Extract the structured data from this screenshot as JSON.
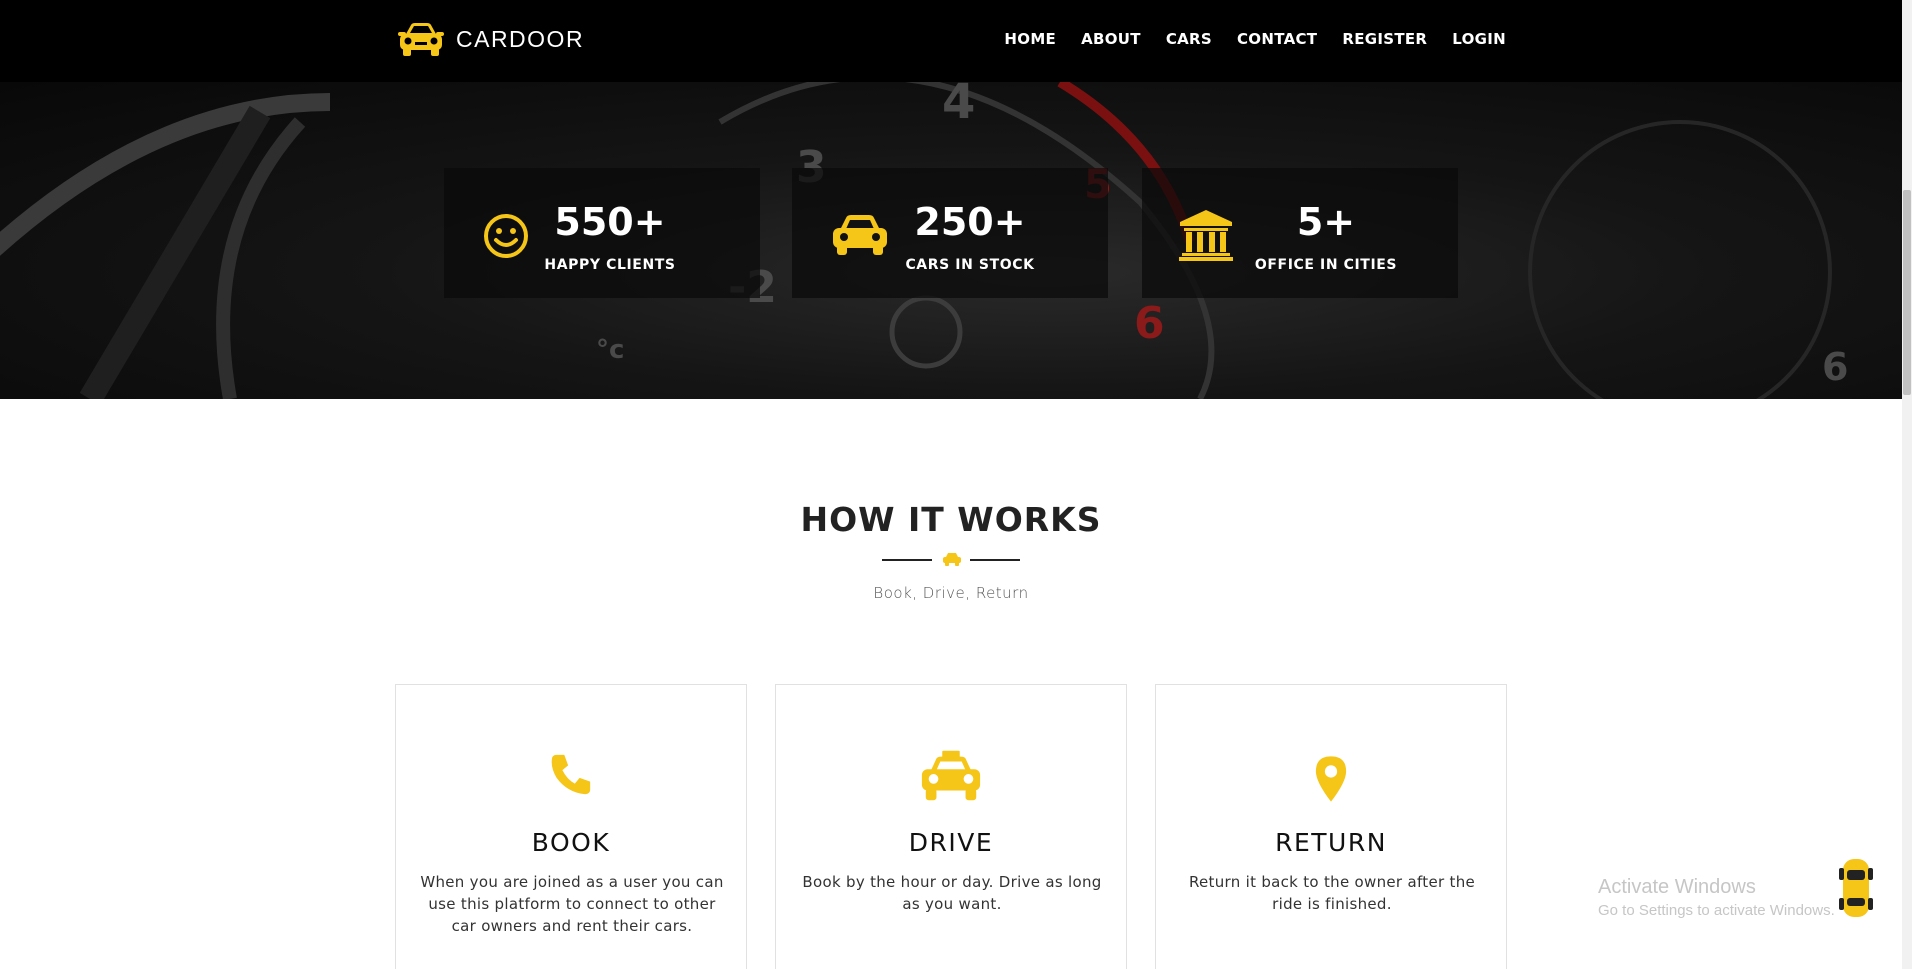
{
  "brand": {
    "name": "CARDOOR",
    "logo_icon": "car-front-icon",
    "accent": "#F5C518"
  },
  "nav": {
    "items": [
      {
        "label": "HOME"
      },
      {
        "label": "ABOUT"
      },
      {
        "label": "CARS"
      },
      {
        "label": "CONTACT"
      },
      {
        "label": "REGISTER"
      },
      {
        "label": "LOGIN"
      }
    ]
  },
  "stats": [
    {
      "value": "550+",
      "label": "HAPPY CLIENTS",
      "icon": "smiley-icon"
    },
    {
      "value": "250+",
      "label": "CARS IN STOCK",
      "icon": "car-icon"
    },
    {
      "value": "5+",
      "label": "OFFICE IN CITIES",
      "icon": "building-icon"
    }
  ],
  "how_it_works": {
    "title": "HOW IT WORKS",
    "subtitle": "Book, Drive, Return",
    "divider_icon": "car-icon",
    "steps": [
      {
        "title": "BOOK",
        "icon": "phone-icon",
        "text": "When you are joined as a user you can use this platform to connect to other car owners and rent their cars."
      },
      {
        "title": "DRIVE",
        "icon": "taxi-icon",
        "text": "Book by the hour or day. Drive as long as you want."
      },
      {
        "title": "RETURN",
        "icon": "map-pin-icon",
        "text": "Return it back to the owner after the ride is finished."
      }
    ]
  },
  "watermark": {
    "title": "Activate Windows",
    "subtitle": "Go to Settings to activate Windows."
  },
  "scroll_top_icon": "yellow-car-top-icon"
}
